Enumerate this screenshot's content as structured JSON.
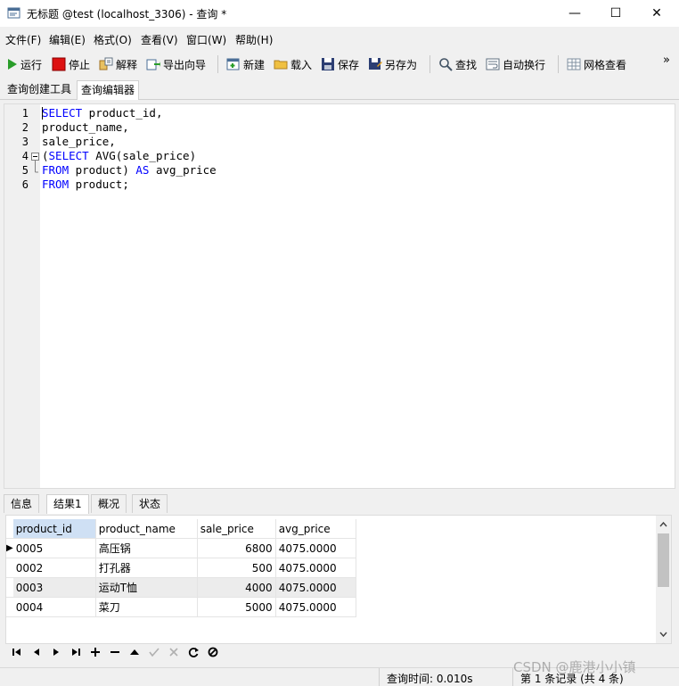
{
  "window": {
    "title": "无标题 @test (localhost_3306) - 查询 *",
    "minimize": "—",
    "maximize": "☐",
    "close": "✕"
  },
  "menu": [
    "文件(F)",
    "编辑(E)",
    "格式(O)",
    "查看(V)",
    "窗口(W)",
    "帮助(H)"
  ],
  "toolbar": {
    "run": "运行",
    "stop": "停止",
    "explain": "解释",
    "export_wizard": "导出向导",
    "new": "新建",
    "load": "载入",
    "save": "保存",
    "save_as": "另存为",
    "find": "查找",
    "word_wrap": "自动换行",
    "grid_view": "网格查看",
    "overflow": "»"
  },
  "query_tabs": [
    "查询创建工具",
    "查询编辑器"
  ],
  "editor": {
    "line_numbers": [
      "1",
      "2",
      "3",
      "4",
      "5",
      "6"
    ]
  },
  "result_tabs": [
    "信息",
    "结果1",
    "概况",
    "状态"
  ],
  "grid": {
    "columns": [
      "product_id",
      "product_name",
      "sale_price",
      "avg_price"
    ],
    "rows": [
      [
        "0005",
        "高压锅",
        "6800",
        "4075.0000"
      ],
      [
        "0002",
        "打孔器",
        "500",
        "4075.0000"
      ],
      [
        "0003",
        "运动T恤",
        "4000",
        "4075.0000"
      ],
      [
        "0004",
        "菜刀",
        "5000",
        "4075.0000"
      ]
    ],
    "current_row_marker": "▶"
  },
  "status": {
    "query_time": "查询时间: 0.010s",
    "records": "第 1 条记录 (共 4 条)",
    "watermark": "CSDN @鹿港小小镇"
  },
  "colors": {
    "keyword": "#0000ff",
    "selected_row": "#ececec"
  }
}
